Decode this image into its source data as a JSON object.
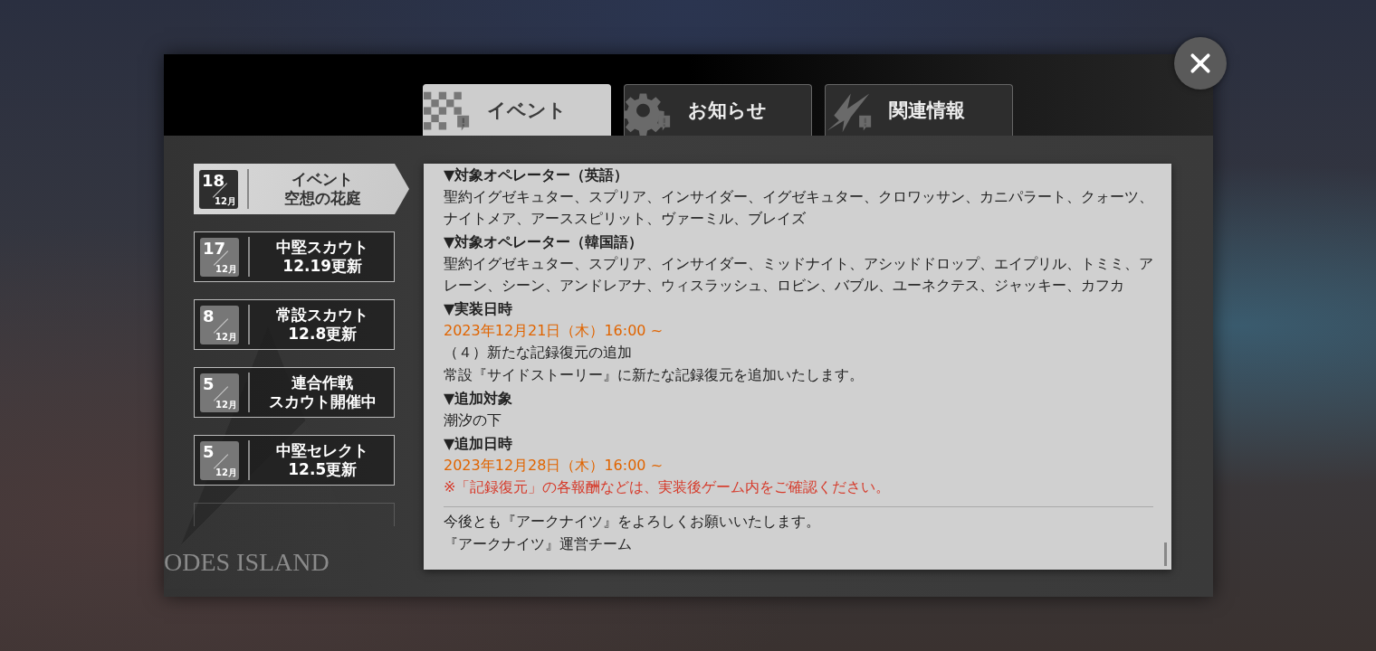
{
  "tabs": [
    {
      "label": "イベント",
      "selected": true
    },
    {
      "label": "お知らせ",
      "selected": false
    },
    {
      "label": "関連情報",
      "selected": false
    }
  ],
  "sidebar": {
    "items": [
      {
        "day": "18",
        "month": "12月",
        "title": [
          "イベント",
          "空想の花庭"
        ],
        "selected": true
      },
      {
        "day": "17",
        "month": "12月",
        "title": [
          "中堅スカウト",
          "12.19更新"
        ],
        "selected": false
      },
      {
        "day": "8",
        "month": "12月",
        "title": [
          "常設スカウト",
          "12.8更新"
        ],
        "selected": false
      },
      {
        "day": "5",
        "month": "12月",
        "title": [
          "連合作戦",
          "スカウト開催中"
        ],
        "selected": false
      },
      {
        "day": "5",
        "month": "12月",
        "title": [
          "中堅セレクト",
          "12.5更新"
        ],
        "selected": false
      }
    ],
    "art_text": "ODES ISLAND"
  },
  "content": {
    "blocks": [
      {
        "kind": "heading",
        "text": "▼対象オペレーター（英語）"
      },
      {
        "kind": "text",
        "text": "聖約イグゼキュター、スプリア、インサイダー、イグゼキュター、クロワッサン、カニパラート、クォーツ、ナイトメア、アーススピリット、ヴァーミル、ブレイズ"
      },
      {
        "kind": "heading",
        "text": "▼対象オペレーター（韓国語）"
      },
      {
        "kind": "text",
        "text": "聖約イグゼキュター、スプリア、インサイダー、ミッドナイト、アシッドドロップ、エイプリル、トミミ、アレーン、シーン、アンドレアナ、ウィスラッシュ、ロビン、バブル、ユーネクテス、ジャッキー、カフカ"
      },
      {
        "kind": "heading",
        "text": "▼実装日時"
      },
      {
        "kind": "date",
        "text": "2023年12月21日（木）16:00 ~"
      },
      {
        "kind": "text",
        "text": "（４）新たな記録復元の追加"
      },
      {
        "kind": "text",
        "text": "常設『サイドストーリー』に新たな記録復元を追加いたします。"
      },
      {
        "kind": "heading",
        "text": "▼追加対象"
      },
      {
        "kind": "text",
        "text": "潮汐の下"
      },
      {
        "kind": "heading",
        "text": "▼追加日時"
      },
      {
        "kind": "date",
        "text": "2023年12月28日（木）16:00 ~"
      },
      {
        "kind": "note",
        "text": "※「記録復元」の各報酬などは、実装後ゲーム内をご確認ください。"
      },
      {
        "kind": "divider"
      },
      {
        "kind": "text",
        "text": "今後とも『アークナイツ』をよろしくお願いいたします。"
      },
      {
        "kind": "text",
        "text": "『アークナイツ』運営チーム"
      }
    ]
  }
}
